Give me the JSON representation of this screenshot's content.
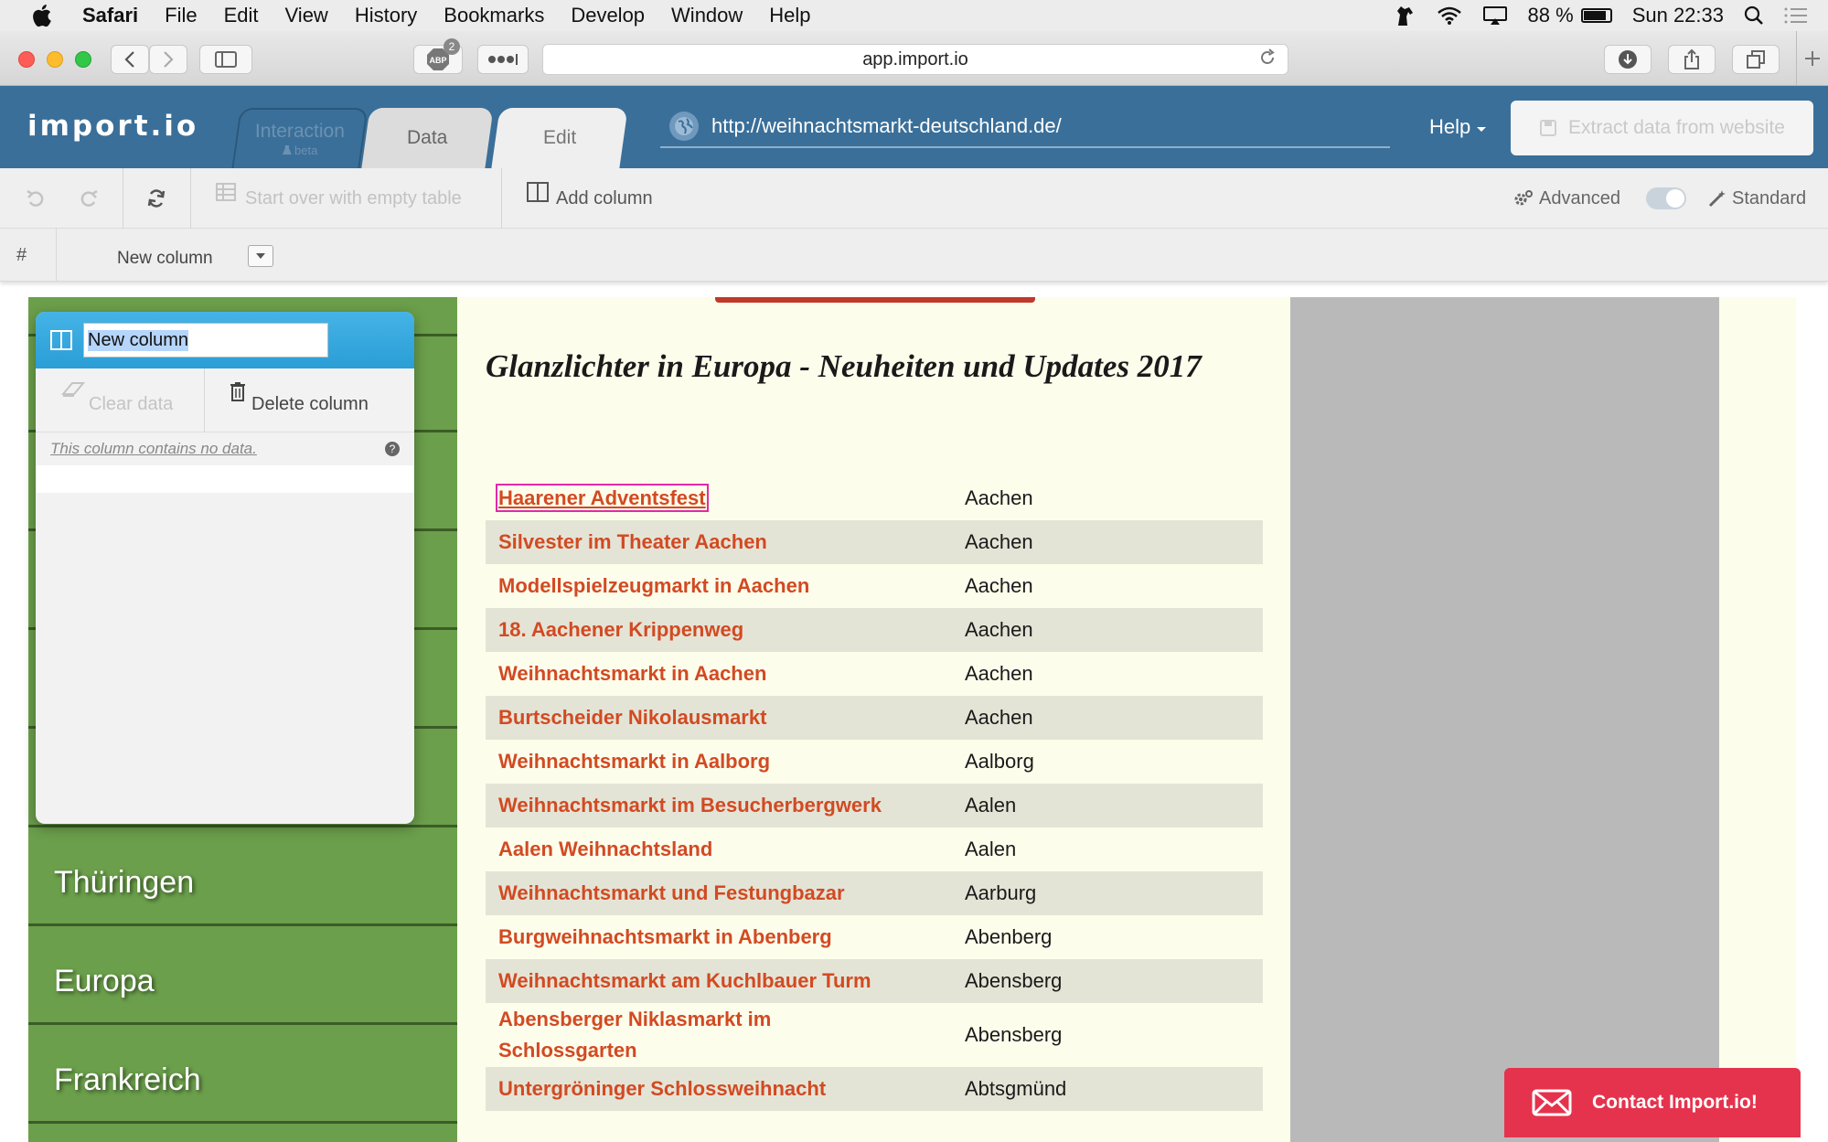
{
  "menubar": {
    "app_name": "Safari",
    "items": [
      "File",
      "Edit",
      "View",
      "History",
      "Bookmarks",
      "Develop",
      "Window",
      "Help"
    ],
    "battery_text": "88 %",
    "battery_level": 0.88,
    "clock": "Sun 22:33"
  },
  "browser": {
    "url": "app.import.io",
    "abp_badge": "2",
    "abp_label": "ABP"
  },
  "app": {
    "logo": "import.io",
    "tabs": {
      "interaction": "Interaction",
      "interaction_badge": "beta",
      "data": "Data",
      "edit": "Edit"
    },
    "site_url": "http://weihnachtsmarkt-deutschland.de/",
    "help": "Help",
    "extract_button": "Extract data from website"
  },
  "toolbar": {
    "start_over": "Start over with empty table",
    "add_column": "Add column",
    "advanced": "Advanced",
    "standard": "Standard",
    "mode_toggle_on": true
  },
  "columns": {
    "hash": "#",
    "first_column": "New column"
  },
  "column_panel": {
    "name_value": "New column",
    "clear_data": "Clear data",
    "delete_column": "Delete column",
    "note": "This column contains no data.",
    "help_icon": "?"
  },
  "website": {
    "sidebar": [
      "Thüringen",
      "Europa",
      "Frankreich"
    ],
    "heading": "Glanzlichter in Europa - Neuheiten und Updates 2017",
    "rows": [
      {
        "name": "Haarener Adventsfest",
        "city": "Aachen"
      },
      {
        "name": "Silvester im Theater Aachen",
        "city": "Aachen"
      },
      {
        "name": "Modellspielzeugmarkt in Aachen",
        "city": "Aachen"
      },
      {
        "name": "18. Aachener Krippenweg",
        "city": "Aachen"
      },
      {
        "name": "Weihnachtsmarkt in Aachen",
        "city": "Aachen"
      },
      {
        "name": "Burtscheider Nikolausmarkt",
        "city": "Aachen"
      },
      {
        "name": "Weihnachtsmarkt in Aalborg",
        "city": "Aalborg"
      },
      {
        "name": "Weihnachtsmarkt im Besucherbergwerk",
        "city": "Aalen"
      },
      {
        "name": "Aalen Weihnachtsland",
        "city": "Aalen"
      },
      {
        "name": "Weihnachtsmarkt und Festungbazar",
        "city": "Aarburg"
      },
      {
        "name": "Burgweihnachtsmarkt in Abenberg",
        "city": "Abenberg"
      },
      {
        "name": "Weihnachtsmarkt am Kuchlbauer Turm",
        "city": "Abensberg"
      },
      {
        "name": "Abensberger Niklasmarkt im Schlossgarten",
        "city": "Abensberg"
      },
      {
        "name": "Untergröninger Schlossweihnacht",
        "city": "Abtsgmünd"
      }
    ]
  },
  "contact_button": "Contact Import.io!",
  "colors": {
    "header_blue": "#3a6f99",
    "sidebar_green": "#6b9f4b",
    "link_orange": "#d24a22",
    "contact_red": "#e5334d",
    "selection_outline": "#e02aa8"
  }
}
